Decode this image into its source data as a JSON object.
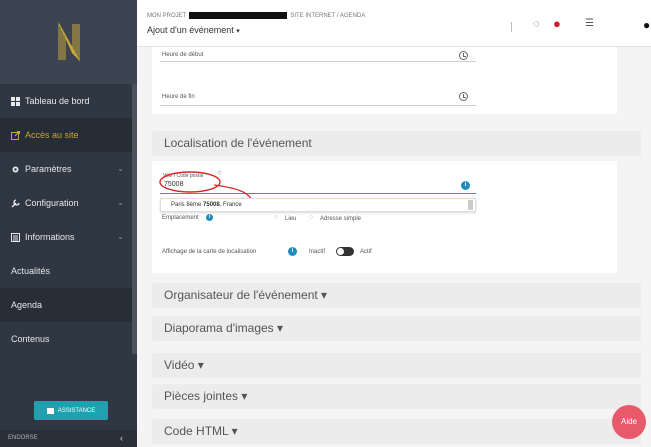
{
  "sidebar": {
    "items": [
      {
        "label": "Tableau de bord",
        "icon": "dashboard-icon"
      },
      {
        "label": "Accès au site",
        "icon": "external-link-icon"
      },
      {
        "label": "Paramètres",
        "icon": "gear-icon"
      },
      {
        "label": "Configuration",
        "icon": "wrench-icon"
      },
      {
        "label": "Informations",
        "icon": "list-icon"
      },
      {
        "label": "Actualités"
      },
      {
        "label": "Agenda"
      },
      {
        "label": "Contenus"
      }
    ],
    "assist_label": "ASSISTANCE",
    "bottom_label": "ENDORSE"
  },
  "header": {
    "breadcrumb_start": "MON PROJET",
    "breadcrumb_end": "SITE INTERNET / AGENDA",
    "title": "Ajout d'un événement",
    "title_caret": "▾"
  },
  "form": {
    "start_label": "Heure de début",
    "end_label": "Heure de fin",
    "location_section": "Localisation de l'événement",
    "city_label": "Ville / Code postal",
    "city_value": "75008",
    "suggestion_start": "Paris 8ème ",
    "suggestion_bold": "75008",
    "suggestion_end": ", France",
    "placement_label": "Emplacement",
    "placement_option1": "Lieu",
    "placement_option2": "Adresse simple",
    "map_label": "Affichage de la carte de localisation",
    "toggle_off": "Inactif",
    "toggle_on": "Actif"
  },
  "sections": [
    "Organisateur de l'événement ▾",
    "Diaporama d'images ▾",
    "Vidéo ▾",
    "Pièces jointes ▾",
    "Code HTML ▾"
  ],
  "aide_label": "Aide",
  "colors": {
    "sidebar_bg": "#2f3742",
    "accent_gold": "#c8a432",
    "info_blue": "#1f8bbf",
    "assist_teal": "#1fa1b0",
    "aide_red": "#e85a6b"
  }
}
